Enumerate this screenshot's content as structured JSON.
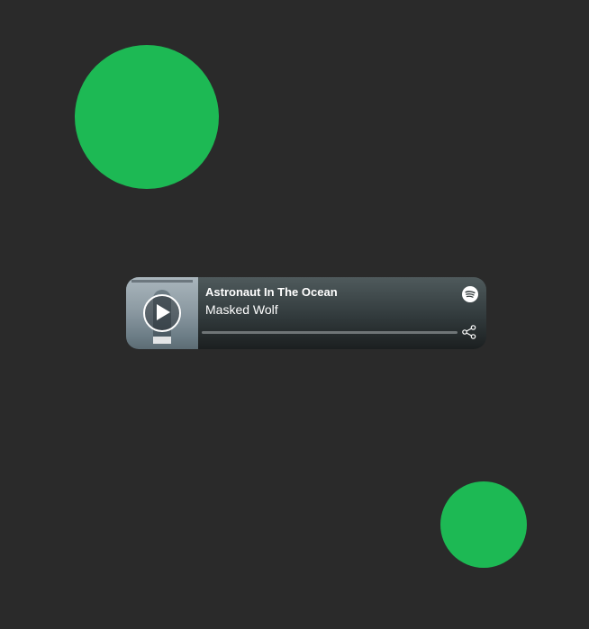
{
  "player": {
    "track_title": "Astronaut In The Ocean",
    "artist": "Masked Wolf",
    "progress": 0,
    "icons": {
      "play": "play-icon",
      "brand": "spotify-icon",
      "share": "share-icon"
    }
  },
  "colors": {
    "background": "#2a2a2a",
    "accent": "#1db954",
    "player_gradient_top": "#4f5a5c",
    "player_gradient_bottom": "#1b1f20"
  }
}
